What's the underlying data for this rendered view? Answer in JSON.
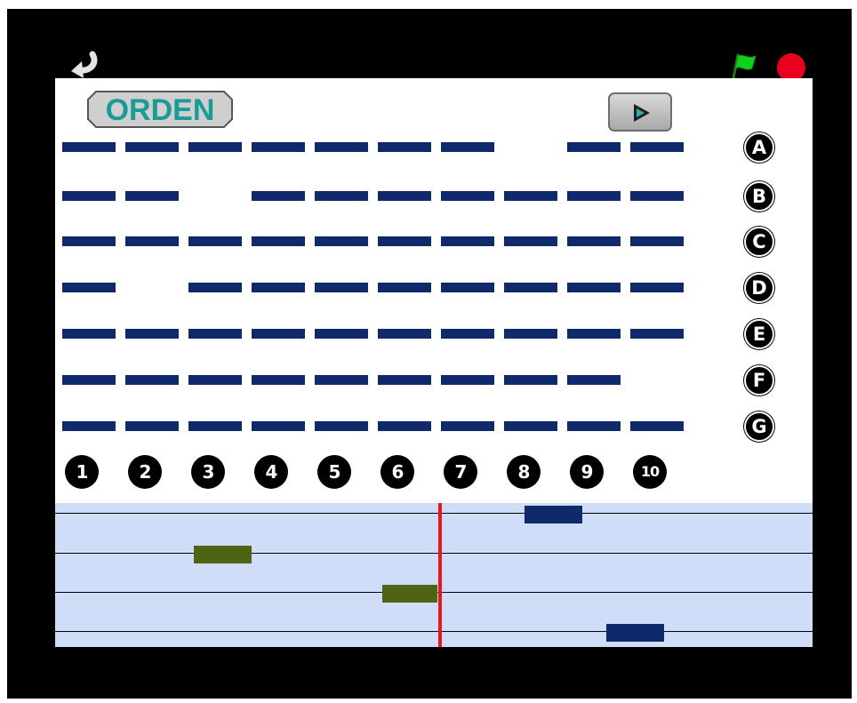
{
  "toolbar": {
    "back_icon": "back-arrow-icon",
    "flag_icon": "green-flag-icon",
    "stop_icon": "stop-icon",
    "flag_color": "#12d018",
    "stop_color": "#e8001c"
  },
  "stage": {
    "order_button_label": "ORDEN",
    "play_icon": "play-icon",
    "row_labels": [
      "A",
      "B",
      "C",
      "D",
      "E",
      "F",
      "G"
    ],
    "column_labels": [
      "1",
      "2",
      "3",
      "4",
      "5",
      "6",
      "7",
      "8",
      "9",
      "10"
    ],
    "grid": [
      [
        1,
        1,
        1,
        1,
        1,
        1,
        1,
        0,
        1,
        1
      ],
      [
        1,
        1,
        0,
        1,
        1,
        1,
        1,
        1,
        1,
        1
      ],
      [
        1,
        1,
        1,
        1,
        1,
        1,
        1,
        1,
        1,
        1
      ],
      [
        1,
        0,
        1,
        1,
        1,
        1,
        1,
        1,
        1,
        1
      ],
      [
        1,
        1,
        1,
        1,
        1,
        1,
        1,
        1,
        1,
        1
      ],
      [
        1,
        1,
        1,
        1,
        1,
        1,
        1,
        1,
        1,
        0
      ],
      [
        1,
        1,
        1,
        1,
        1,
        1,
        1,
        1,
        1,
        1
      ]
    ],
    "dash_color": "#0f2a6b"
  },
  "timeline": {
    "lanes": 4,
    "playhead_color": "#e81818",
    "notes": [
      {
        "lane": 0,
        "position": 0.62,
        "length": 0.076,
        "color": "#0f2a6b"
      },
      {
        "lane": 1,
        "position": 0.183,
        "length": 0.076,
        "color": "#4f6412"
      },
      {
        "lane": 2,
        "position": 0.432,
        "length": 0.073,
        "color": "#4f6412"
      },
      {
        "lane": 3,
        "position": 0.728,
        "length": 0.076,
        "color": "#0f2a6b"
      }
    ],
    "playhead_position": 0.506
  }
}
